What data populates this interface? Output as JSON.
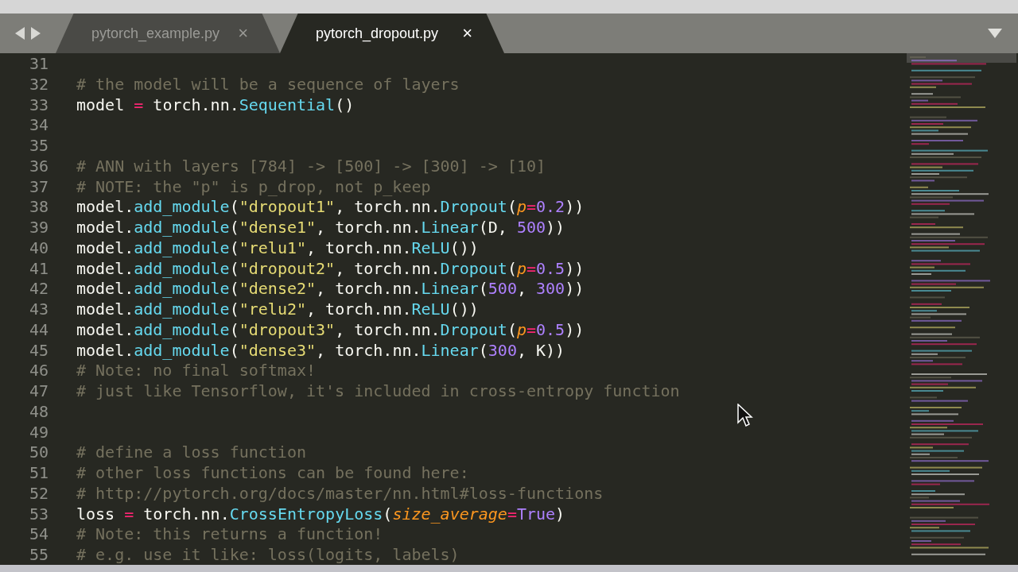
{
  "tabs": [
    {
      "label": "pytorch_example.py",
      "close": "×",
      "selected": false
    },
    {
      "label": "pytorch_dropout.py",
      "close": "×",
      "selected": true
    }
  ],
  "editor": {
    "lines": [
      {
        "number": "31"
      },
      {
        "number": "32",
        "tokens": [
          {
            "kind": "comment",
            "text": "# the model will be a sequence of layers"
          }
        ]
      },
      {
        "number": "33",
        "tokens": [
          {
            "kind": "plain",
            "text": "model "
          },
          {
            "kind": "operator",
            "text": "="
          },
          {
            "kind": "plain",
            "text": " torch.nn."
          },
          {
            "kind": "function",
            "text": "Sequential"
          },
          {
            "kind": "plain",
            "text": "()"
          }
        ]
      },
      {
        "number": "34"
      },
      {
        "number": "35"
      },
      {
        "number": "36",
        "tokens": [
          {
            "kind": "comment",
            "text": "# ANN with layers [784] -> [500] -> [300] -> [10]"
          }
        ]
      },
      {
        "number": "37",
        "tokens": [
          {
            "kind": "comment",
            "text": "# NOTE: the \"p\" is p_drop, not p_keep"
          }
        ]
      },
      {
        "number": "38",
        "tokens": [
          {
            "kind": "plain",
            "text": "model."
          },
          {
            "kind": "function",
            "text": "add_module"
          },
          {
            "kind": "plain",
            "text": "("
          },
          {
            "kind": "string",
            "text": "\"dropout1\""
          },
          {
            "kind": "plain",
            "text": ", torch.nn."
          },
          {
            "kind": "function",
            "text": "Dropout"
          },
          {
            "kind": "plain",
            "text": "("
          },
          {
            "kind": "parameter",
            "text": "p"
          },
          {
            "kind": "operator",
            "text": "="
          },
          {
            "kind": "number",
            "text": "0.2"
          },
          {
            "kind": "plain",
            "text": "))"
          }
        ]
      },
      {
        "number": "39",
        "tokens": [
          {
            "kind": "plain",
            "text": "model."
          },
          {
            "kind": "function",
            "text": "add_module"
          },
          {
            "kind": "plain",
            "text": "("
          },
          {
            "kind": "string",
            "text": "\"dense1\""
          },
          {
            "kind": "plain",
            "text": ", torch.nn."
          },
          {
            "kind": "function",
            "text": "Linear"
          },
          {
            "kind": "plain",
            "text": "(D, "
          },
          {
            "kind": "number",
            "text": "500"
          },
          {
            "kind": "plain",
            "text": "))"
          }
        ]
      },
      {
        "number": "40",
        "tokens": [
          {
            "kind": "plain",
            "text": "model."
          },
          {
            "kind": "function",
            "text": "add_module"
          },
          {
            "kind": "plain",
            "text": "("
          },
          {
            "kind": "string",
            "text": "\"relu1\""
          },
          {
            "kind": "plain",
            "text": ", torch.nn."
          },
          {
            "kind": "function",
            "text": "ReLU"
          },
          {
            "kind": "plain",
            "text": "())"
          }
        ]
      },
      {
        "number": "41",
        "tokens": [
          {
            "kind": "plain",
            "text": "model."
          },
          {
            "kind": "function",
            "text": "add_module"
          },
          {
            "kind": "plain",
            "text": "("
          },
          {
            "kind": "string",
            "text": "\"dropout2\""
          },
          {
            "kind": "plain",
            "text": ", torch.nn."
          },
          {
            "kind": "function",
            "text": "Dropout"
          },
          {
            "kind": "plain",
            "text": "("
          },
          {
            "kind": "parameter",
            "text": "p"
          },
          {
            "kind": "operator",
            "text": "="
          },
          {
            "kind": "number",
            "text": "0.5"
          },
          {
            "kind": "plain",
            "text": "))"
          }
        ]
      },
      {
        "number": "42",
        "tokens": [
          {
            "kind": "plain",
            "text": "model."
          },
          {
            "kind": "function",
            "text": "add_module"
          },
          {
            "kind": "plain",
            "text": "("
          },
          {
            "kind": "string",
            "text": "\"dense2\""
          },
          {
            "kind": "plain",
            "text": ", torch.nn."
          },
          {
            "kind": "function",
            "text": "Linear"
          },
          {
            "kind": "plain",
            "text": "("
          },
          {
            "kind": "number",
            "text": "500"
          },
          {
            "kind": "plain",
            "text": ", "
          },
          {
            "kind": "number",
            "text": "300"
          },
          {
            "kind": "plain",
            "text": "))"
          }
        ]
      },
      {
        "number": "43",
        "tokens": [
          {
            "kind": "plain",
            "text": "model."
          },
          {
            "kind": "function",
            "text": "add_module"
          },
          {
            "kind": "plain",
            "text": "("
          },
          {
            "kind": "string",
            "text": "\"relu2\""
          },
          {
            "kind": "plain",
            "text": ", torch.nn."
          },
          {
            "kind": "function",
            "text": "ReLU"
          },
          {
            "kind": "plain",
            "text": "())"
          }
        ]
      },
      {
        "number": "44",
        "tokens": [
          {
            "kind": "plain",
            "text": "model."
          },
          {
            "kind": "function",
            "text": "add_module"
          },
          {
            "kind": "plain",
            "text": "("
          },
          {
            "kind": "string",
            "text": "\"dropout3\""
          },
          {
            "kind": "plain",
            "text": ", torch.nn."
          },
          {
            "kind": "function",
            "text": "Dropout"
          },
          {
            "kind": "plain",
            "text": "("
          },
          {
            "kind": "parameter",
            "text": "p"
          },
          {
            "kind": "operator",
            "text": "="
          },
          {
            "kind": "number",
            "text": "0.5"
          },
          {
            "kind": "plain",
            "text": "))"
          }
        ]
      },
      {
        "number": "45",
        "tokens": [
          {
            "kind": "plain",
            "text": "model."
          },
          {
            "kind": "function",
            "text": "add_module"
          },
          {
            "kind": "plain",
            "text": "("
          },
          {
            "kind": "string",
            "text": "\"dense3\""
          },
          {
            "kind": "plain",
            "text": ", torch.nn."
          },
          {
            "kind": "function",
            "text": "Linear"
          },
          {
            "kind": "plain",
            "text": "("
          },
          {
            "kind": "number",
            "text": "300"
          },
          {
            "kind": "plain",
            "text": ", K))"
          }
        ]
      },
      {
        "number": "46",
        "tokens": [
          {
            "kind": "comment",
            "text": "# Note: no final softmax!"
          }
        ]
      },
      {
        "number": "47",
        "tokens": [
          {
            "kind": "comment",
            "text": "# just like Tensorflow, it's included in cross-entropy function"
          }
        ]
      },
      {
        "number": "48"
      },
      {
        "number": "49"
      },
      {
        "number": "50",
        "tokens": [
          {
            "kind": "comment",
            "text": "# define a loss function"
          }
        ]
      },
      {
        "number": "51",
        "tokens": [
          {
            "kind": "comment",
            "text": "# other loss functions can be found here:"
          }
        ]
      },
      {
        "number": "52",
        "tokens": [
          {
            "kind": "comment",
            "text": "# http://pytorch.org/docs/master/nn.html#loss-functions"
          }
        ]
      },
      {
        "number": "53",
        "tokens": [
          {
            "kind": "plain",
            "text": "loss "
          },
          {
            "kind": "operator",
            "text": "="
          },
          {
            "kind": "plain",
            "text": " torch.nn."
          },
          {
            "kind": "function",
            "text": "CrossEntropyLoss"
          },
          {
            "kind": "plain",
            "text": "("
          },
          {
            "kind": "parameter",
            "text": "size_average"
          },
          {
            "kind": "operator",
            "text": "="
          },
          {
            "kind": "number",
            "text": "True"
          },
          {
            "kind": "plain",
            "text": ")"
          }
        ]
      },
      {
        "number": "54",
        "tokens": [
          {
            "kind": "comment",
            "text": "# Note: this returns a function!"
          }
        ]
      },
      {
        "number": "55",
        "tokens": [
          {
            "kind": "comment",
            "text": "# e.g. use it like: loss(logits, labels)"
          }
        ]
      }
    ]
  }
}
